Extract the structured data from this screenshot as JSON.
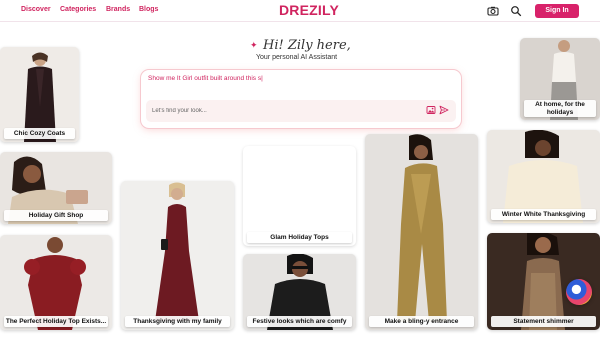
{
  "nav": {
    "links": [
      "Discover",
      "Categories",
      "Brands",
      "Blogs"
    ],
    "logo": "DREZILY",
    "sign_in": "Sign In",
    "icons": [
      "camera-icon",
      "search-icon"
    ]
  },
  "assistant": {
    "greeting": "Hi! Zily here,",
    "subtitle": "Your personal AI Assistant",
    "prompt": "Show me It Girl outfit built around this s|",
    "input_placeholder": "Let's find your look...",
    "input_icons": [
      "image-upload-icon",
      "send-icon"
    ]
  },
  "cards": [
    {
      "label": "Chic Cozy Coats"
    },
    {
      "label": "Holiday Gift Shop"
    },
    {
      "label": "The Perfect Holiday Top Exists..."
    },
    {
      "label": "Thanksgiving with my family"
    },
    {
      "label": "Glam Holiday Tops"
    },
    {
      "label": "Festive looks which are comfy"
    },
    {
      "label": "Make a bling-y entrance"
    },
    {
      "label": "At home, for the holidays"
    },
    {
      "label": "Winter White Thanksgiving"
    },
    {
      "label": "Statement shimmer"
    }
  ],
  "colors": {
    "accent": "#d0245f",
    "signin_bg": "#d8226a",
    "prompt_glow": "#f6c9cf"
  }
}
